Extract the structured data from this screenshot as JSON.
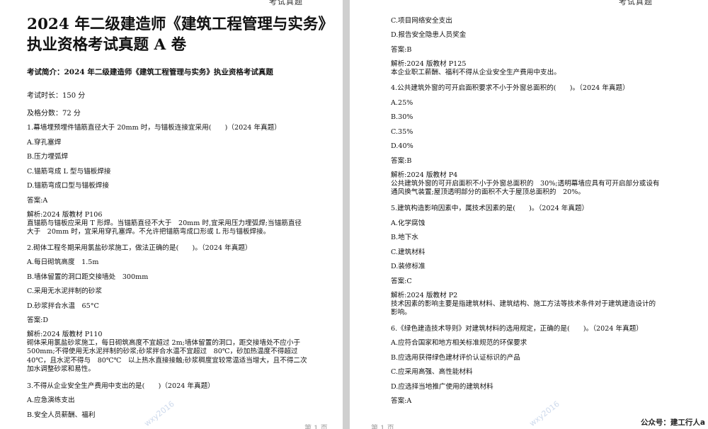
{
  "header_mark": "考试真题",
  "footer_mark": "第 1 页",
  "watermark": "wxy2016",
  "left": {
    "title_line1": "2024 年二级建造师《建筑工程管理与实务》",
    "title_line2": "执业资格考试真题 A 卷",
    "intro": "考试简介：2024 年二级建造师《建筑工程管理与实务》执业资格考试真题",
    "duration": "考试时长：150 分",
    "pass_score": "及格分数：72 分",
    "q1": {
      "stem": "1.幕墙埋预埋件锚筋直径大于 20mm 时，与锚板连接宜采用(　　)（2024 年真题）",
      "options": [
        "A.穿孔塞焊",
        "B.压力埋弧焊",
        "C.锚筋弯成 L 型与锚板焊接",
        "D.锚筋弯成口型与锚板焊接"
      ],
      "answer": "答案:A",
      "analysis": [
        "解析:2024 版教材 P106",
        "直锚筋与锚板应采用 T 形焊。当锚筋直径不大于　20mm 时,宜采用压力埋弧焊;当锚筋直径",
        "大于　20mm 时，宜采用穿孔塞焊。不允许把锚筋弯成口形或 L 形与锚板焊接。"
      ]
    },
    "q2": {
      "stem": "2.砌体工程冬期采用氯盐砂浆施工，做法正确的是(　　)。（2024 年真题）",
      "options": [
        "A.每日砌筑高度　1.5m",
        "B.墙体留置的洞口距交接墙处　300mm",
        "C.采用无水泥拌制的砂浆",
        "D.砂浆拌合水温　65°C"
      ],
      "answer": "答案:D",
      "analysis": [
        "解析:2024 版教材 P110",
        "砌体采用氯盐砂浆施工，每日砌筑高度不宜超过 2m;墙体留置的洞口，距交接墙处不应小于",
        "500mm;不得使用无水泥拌制的砂浆;砂浆拌合水温不宜超过　80℃，砂加热温度不得超过",
        "40℃，且水泥不得与　80℃℃　以上热水直接接触;砂浆稠度宜较常温适当增大，且不得二次",
        "加水调整砂浆和易性。"
      ]
    },
    "q3": {
      "stem": "3.不得从企业安全生产费用中支出的是(　　)（2024 年真题）",
      "options": [
        "A.应急演练支出",
        "B.安全人员薪酬、福利"
      ]
    }
  },
  "right": {
    "q3_rest": {
      "options": [
        "C.项目网络安全支出",
        "D.报告安全隐患人员奖金"
      ],
      "answer": "答案:B",
      "analysis": [
        "解析:2024 版教材 P125",
        "本企业职工薪酬、福利不得从企业安全生产费用中支出。"
      ]
    },
    "q4": {
      "stem": "4.公共建筑外窗的可开启面积要求不小于外窗总面积的(　　)。（2024 年真题）",
      "options": [
        "A.25%",
        "B.30%",
        "C.35%",
        "D.40%"
      ],
      "answer": "答案:B",
      "analysis": [
        "解析:2024 版教材 P4",
        "公共建筑外窗的可开启面积不小于外窗总面积的　30%;透明幕墙应具有可开启部分或设有",
        "通风换气装置;屋顶透明部分的面积不大于屋顶总面积的　20%。"
      ]
    },
    "q5": {
      "stem": "5.建筑构造影响因素中，属技术因素的是(　　)。（2024 年真题）",
      "options": [
        "A.化学腐蚀",
        "B.地下水",
        "C.建筑材料",
        "D.装修标准"
      ],
      "answer": "答案:C",
      "analysis": [
        "解析:2024 版教材 P2",
        "技术因素的影响主要是指建筑材料、建筑结构、施工方法等技术条件对于建筑建造设计的",
        "影响。"
      ]
    },
    "q6": {
      "stem": "6.《绿色建造技术导则》对建筑材料的选用规定，正确的是(　　)。（2024 年真题）",
      "options": [
        "A.应符合国家和地方相关标准规范的环保要求",
        "B.应选用获得绿色建材评价认证标识的产品",
        "C.应采用高强、高性能材料",
        "D.应选择当地推广使用的建筑材料"
      ],
      "answer": "答案:A"
    },
    "account": "公众号：建工行人a"
  }
}
